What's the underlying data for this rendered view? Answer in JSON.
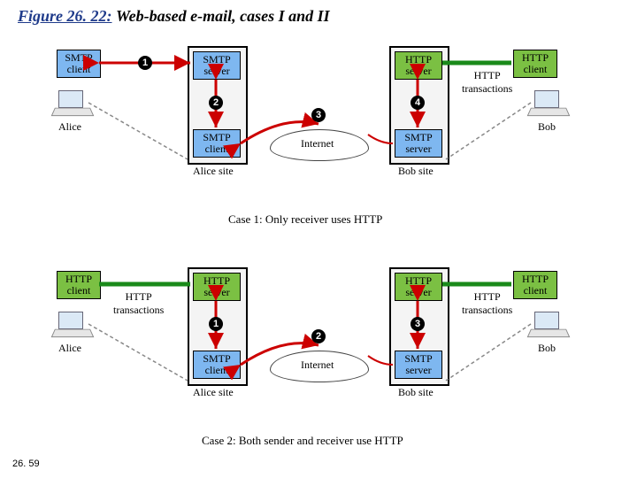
{
  "figure": {
    "number": "Figure 26. 22:",
    "title": " Web-based e-mail, cases I and II"
  },
  "page": "26. 59",
  "case1": {
    "caption": "Case 1: Only receiver uses HTTP",
    "alice": "Alice",
    "bob": "Bob",
    "aliceSite": "Alice site",
    "bobSite": "Bob site",
    "internet": "Internet",
    "httpTx": "HTTP\ntransactions",
    "aliceClient": "SMTP\nclient",
    "aliceTop": "SMTP\nserver",
    "aliceBot": "SMTP\nclient",
    "bobTop": "HTTP\nserver",
    "bobBot": "SMTP\nserver",
    "bobClient": "HTTP\nclient",
    "n1": "1",
    "n2": "2",
    "n3": "3",
    "n4": "4"
  },
  "case2": {
    "caption": "Case 2: Both sender and receiver use HTTP",
    "alice": "Alice",
    "bob": "Bob",
    "aliceSite": "Alice site",
    "bobSite": "Bob site",
    "internet": "Internet",
    "httpTxL": "HTTP\ntransactions",
    "httpTxR": "HTTP\ntransactions",
    "aliceClient": "HTTP\nclient",
    "aliceTop": "HTTP\nserver",
    "aliceBot": "SMTP\nclient",
    "bobTop": "HTTP\nserver",
    "bobBot": "SMTP\nserver",
    "bobClient": "HTTP\nclient",
    "n1": "1",
    "n2": "2",
    "n3": "3"
  }
}
